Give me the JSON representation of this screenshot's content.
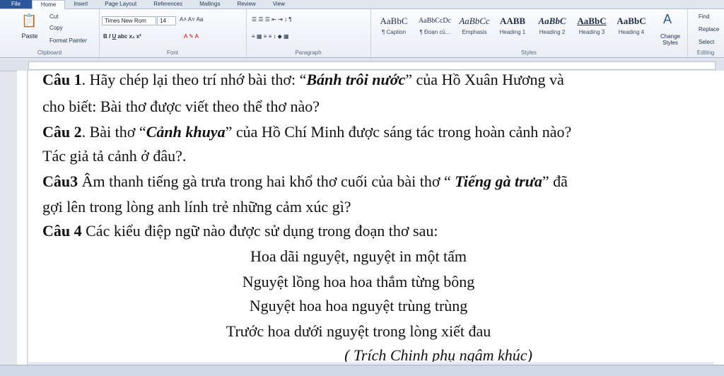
{
  "tabs": [
    "File",
    "Home",
    "Insert",
    "Page Layout",
    "References",
    "Mailings",
    "Review",
    "View"
  ],
  "clipboard": {
    "cut": "Cut",
    "copy": "Copy",
    "paste": "Paste",
    "format_painter": "Format Painter",
    "label": "Clipboard"
  },
  "font": {
    "name": "Times New Rom",
    "size": "14",
    "label": "Font"
  },
  "paragraph": {
    "label": "Paragraph"
  },
  "styles": {
    "label": "Styles",
    "items": [
      {
        "sample": "AaBbC",
        "name": "¶ Caption"
      },
      {
        "sample": "AaBbCcDc",
        "name": "¶ Đoạn củ..."
      },
      {
        "sample": "AaBbCc",
        "name": "Emphasis"
      },
      {
        "sample": "AABB",
        "name": "Heading 1"
      },
      {
        "sample": "AaBbC",
        "name": "Heading 2"
      },
      {
        "sample": "AaBbC",
        "name": "Heading 3"
      },
      {
        "sample": "AaBbC",
        "name": "Heading 4"
      }
    ],
    "change_styles": "Change Styles"
  },
  "editing": {
    "find": "Find",
    "replace": "Replace",
    "select": "Select",
    "label": "Editing"
  },
  "document": {
    "q1_b": "Câu 1",
    "q1_t": ". Hãy chép lại theo trí nhớ bài thơ: “",
    "q1_i": "Bánh trôi nước",
    "q1_t2": "” của Hồ Xuân Hương và",
    "q1_l2": "cho biết: Bài thơ được viết theo thể thơ nào?",
    "q2_b": "Câu 2",
    "q2_t": ". Bài thơ “",
    "q2_i": "Cảnh khuya",
    "q2_t2": "” của Hồ Chí Minh được sáng tác trong hoàn cảnh nào?",
    "q2_l2": "Tác giả tả cảnh ở đâu?.",
    "q3_b": "Câu3",
    "q3_t": " Âm thanh tiếng gà trưa trong hai khổ thơ cuối của bài thơ “ ",
    "q3_i": "Tiếng gà trưa",
    "q3_t2": "” đã",
    "q3_l2": "gợi lên trong lòng anh lính trẻ những cảm xúc gì?",
    "q4_b": "Câu 4",
    "q4_t": " Các kiểu điệp ngữ nào được sử dụng trong đoạn thơ sau:",
    "poem": [
      "Hoa dãi nguyệt, nguyệt in một tấm",
      "Nguyệt lồng hoa hoa thắm từng bông",
      "Nguyệt hoa hoa nguyệt trùng trùng",
      "Trước hoa dưới nguyệt trong lòng xiết đau"
    ],
    "source": "( Trích Chinh phụ ngâm khúc)"
  }
}
